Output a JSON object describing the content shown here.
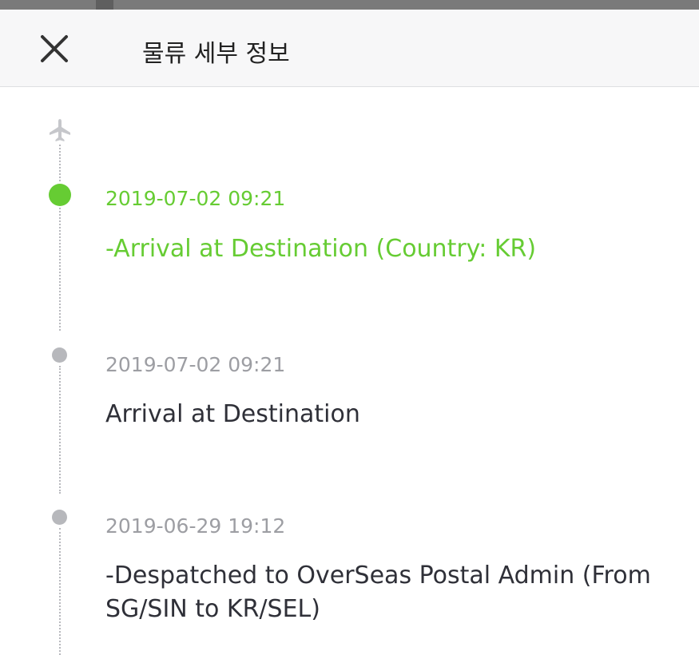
{
  "header": {
    "title": "물류 세부 정보",
    "close_icon": "close-icon"
  },
  "colors": {
    "active": "#66cc33",
    "inactive": "#b7b8bc",
    "plane": "#c6c7cb"
  },
  "timeline": {
    "start_icon": "airplane-icon",
    "events": [
      {
        "date": "2019-07-02 09:21",
        "description": "-Arrival at Destination (Country: KR)",
        "status": "current"
      },
      {
        "date": "2019-07-02 09:21",
        "description": "Arrival at Destination",
        "status": "past"
      },
      {
        "date": "2019-06-29 19:12",
        "description": "-Despatched to OverSeas Postal Admin (From SG/SIN to KR/SEL)",
        "status": "past"
      }
    ]
  }
}
